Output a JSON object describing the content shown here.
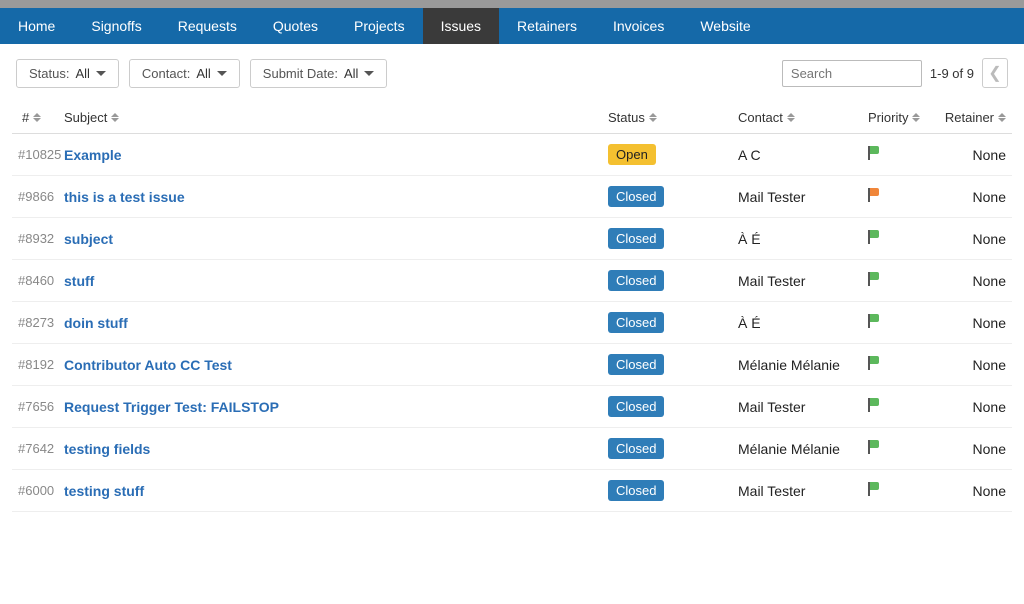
{
  "nav": {
    "items": [
      {
        "label": "Home"
      },
      {
        "label": "Signoffs"
      },
      {
        "label": "Requests"
      },
      {
        "label": "Quotes"
      },
      {
        "label": "Projects"
      },
      {
        "label": "Issues"
      },
      {
        "label": "Retainers"
      },
      {
        "label": "Invoices"
      },
      {
        "label": "Website"
      }
    ],
    "active_index": 5
  },
  "filters": {
    "status": {
      "label": "Status:",
      "value": "All"
    },
    "contact": {
      "label": "Contact:",
      "value": "All"
    },
    "submit_date": {
      "label": "Submit Date:",
      "value": "All"
    }
  },
  "search": {
    "placeholder": "Search"
  },
  "pagination": {
    "info": "1-9 of 9"
  },
  "columns": {
    "num": "#",
    "subject": "Subject",
    "status": "Status",
    "contact": "Contact",
    "priority": "Priority",
    "retainer": "Retainer"
  },
  "issues": [
    {
      "id": "#10825",
      "subject": "Example",
      "status": "Open",
      "contact": "A C",
      "priority": "green",
      "retainer": "None"
    },
    {
      "id": "#9866",
      "subject": "this is a test issue",
      "status": "Closed",
      "contact": "Mail Tester",
      "priority": "orange",
      "retainer": "None"
    },
    {
      "id": "#8932",
      "subject": "subject",
      "status": "Closed",
      "contact": "À É",
      "priority": "green",
      "retainer": "None"
    },
    {
      "id": "#8460",
      "subject": "stuff",
      "status": "Closed",
      "contact": "Mail Tester",
      "priority": "green",
      "retainer": "None"
    },
    {
      "id": "#8273",
      "subject": "doin stuff",
      "status": "Closed",
      "contact": "À É",
      "priority": "green",
      "retainer": "None"
    },
    {
      "id": "#8192",
      "subject": "Contributor Auto CC Test",
      "status": "Closed",
      "contact": "Mélanie Mélanie",
      "priority": "green",
      "retainer": "None"
    },
    {
      "id": "#7656",
      "subject": "Request Trigger Test: FAILSTOP",
      "status": "Closed",
      "contact": "Mail Tester",
      "priority": "green",
      "retainer": "None"
    },
    {
      "id": "#7642",
      "subject": "testing fields",
      "status": "Closed",
      "contact": "Mélanie Mélanie",
      "priority": "green",
      "retainer": "None"
    },
    {
      "id": "#6000",
      "subject": "testing stuff",
      "status": "Closed",
      "contact": "Mail Tester",
      "priority": "green",
      "retainer": "None"
    }
  ]
}
